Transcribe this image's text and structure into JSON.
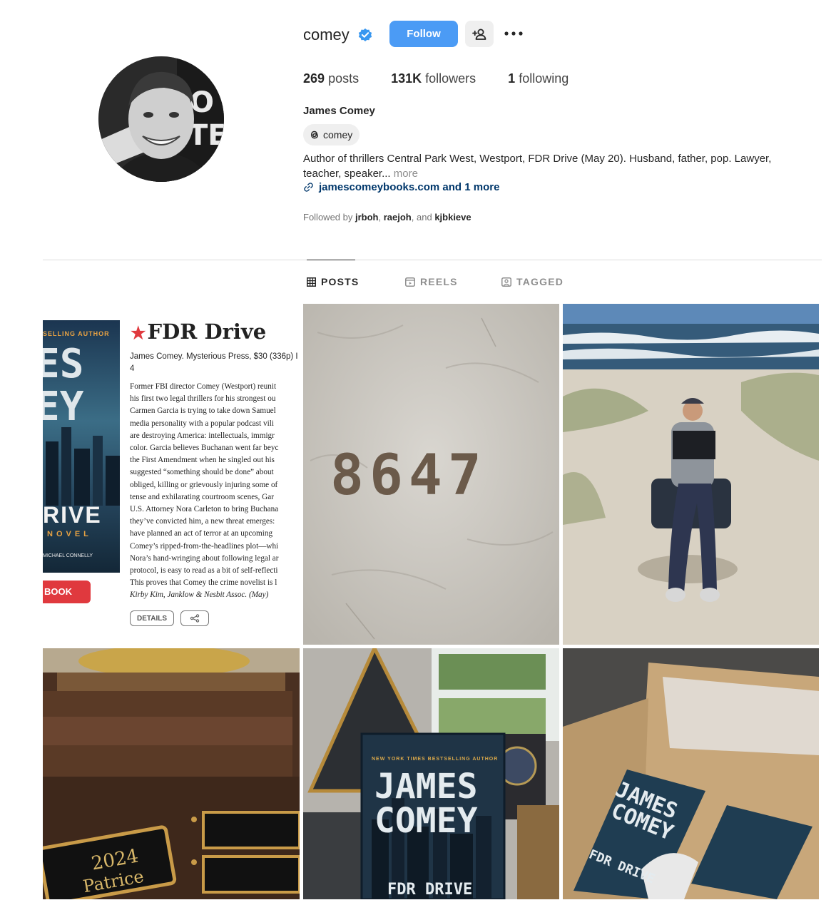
{
  "profile": {
    "username": "comey",
    "full_name": "James Comey",
    "follow_label": "Follow",
    "posts_count": "269",
    "posts_label": "posts",
    "followers_count": "131K",
    "followers_label": "followers",
    "following_count": "1",
    "following_label": "following",
    "threads_handle": "comey",
    "bio_line1": "Author of thrillers Central Park West, Westport, FDR Drive (May 20). Husband, father, pop. Lawyer,",
    "bio_line2": "teacher, speaker...",
    "bio_more": "more",
    "link": "jamescomeybooks.com and 1 more",
    "followed_by_prefix": "Followed by",
    "followed_by_1": "jrboh",
    "followed_by_2": "raejoh",
    "followed_by_and": "and",
    "followed_by_3": "kjbkieve"
  },
  "tabs": [
    {
      "label": "POSTS",
      "icon": "grid-icon",
      "active": true
    },
    {
      "label": "REELS",
      "icon": "reels-icon",
      "active": false
    },
    {
      "label": "TAGGED",
      "icon": "tagged-icon",
      "active": false
    }
  ],
  "posts": {
    "review": {
      "cover_top": "SELLING AUTHOR",
      "cover_line1": "ES",
      "cover_line2": "EY",
      "cover_rive": "RIVE",
      "cover_novel": "NOVEL",
      "cover_mc": "MICHAEL CONNELLY",
      "buy_label": "BOOK",
      "title": "FDR Drive",
      "meta_line1": "James Comey. Mysterious Press, $30 (336p) I",
      "meta_line2": "4",
      "body": [
        "Former FBI director Comey (Westport) reunit",
        "his first two legal thrillers for his strongest ou",
        "Carmen Garcia is trying to take down Samuel",
        "media personality with a popular podcast vili",
        "are destroying America: intellectuals, immigr",
        "color. Garcia believes Buchanan went far beyc",
        "the First Amendment when he singled out his",
        "suggested “something should be done” about",
        "obliged, killing or grievously injuring some of",
        "tense and exhilarating courtroom scenes, Gar",
        "U.S. Attorney Nora Carleton to bring Buchana",
        "they’ve convicted him, a new threat emerges:",
        "have planned an act of terror at an upcoming",
        "Comey’s ripped-from-the-headlines plot—whi",
        "Nora’s hand-wringing about following legal ar",
        "protocol, is easy to read as a bit of self-reflecti",
        "This proves that Comey the crime novelist is l"
      ],
      "agent_line": "Kirby Kim, Janklow & Nesbit Assoc. (May)",
      "details_label": "DETAILS"
    },
    "sand_digits": "8647",
    "plaque_year": "2024",
    "plaque_name": "Patrice",
    "book_line1": "JAMES",
    "book_line2": "COMEY",
    "book_subtitle": "FDR DRIVE",
    "book_top": "NEW YORK TIMES BESTSELLING AUTHOR",
    "box_line1": "JAMES",
    "box_line2": "COMEY",
    "box_title": "FDR DRIVE"
  },
  "colors": {
    "accent": "#4b9bf5",
    "verified": "#3897f0",
    "link": "#00376b",
    "review_red": "#e0393e"
  }
}
